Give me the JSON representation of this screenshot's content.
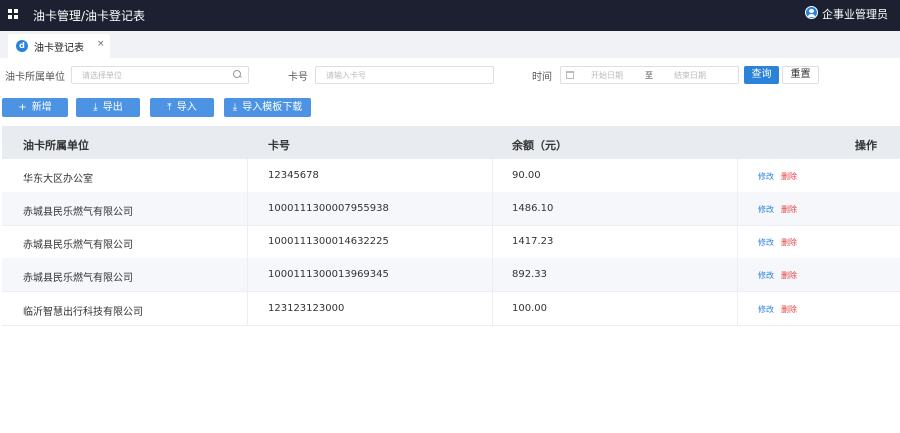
{
  "header": {
    "title": "油卡管理/油卡登记表",
    "user_name": "企事业管理员"
  },
  "tabs": [
    {
      "label": "油卡登记表",
      "icon_letter": "d",
      "close": "×"
    }
  ],
  "filters": {
    "unit_label": "油卡所属单位",
    "unit_placeholder": "请选择单位",
    "card_label": "卡号",
    "card_placeholder": "请输入卡号",
    "time_label": "时间",
    "start_placeholder": "开始日期",
    "date_separator": "至",
    "end_placeholder": "结束日期",
    "query_label": "查询",
    "reset_label": "重置"
  },
  "actions": {
    "add": {
      "icon": "+",
      "label": "新增"
    },
    "export": {
      "icon": "⤓",
      "label": "导出"
    },
    "import": {
      "icon": "⤒",
      "label": "导入"
    },
    "template": {
      "icon": "⤓",
      "label": "导入模板下载"
    }
  },
  "table": {
    "columns": [
      "油卡所属单位",
      "卡号",
      "余额（元）",
      "操作"
    ],
    "edit_label": "修改",
    "delete_label": "删除",
    "rows": [
      {
        "unit": "华东大区办公室",
        "card": "12345678",
        "balance": "90.00"
      },
      {
        "unit": "赤城县民乐燃气有限公司",
        "card": "1000111300007955938",
        "balance": "1486.10"
      },
      {
        "unit": "赤城县民乐燃气有限公司",
        "card": "1000111300014632225",
        "balance": "1417.23"
      },
      {
        "unit": "赤城县民乐燃气有限公司",
        "card": "1000111300013969345",
        "balance": "892.33"
      },
      {
        "unit": "临沂智慧出行科技有限公司",
        "card": "123123123000",
        "balance": "100.00"
      }
    ]
  },
  "colors": {
    "topbar": "#1c2030",
    "primary": "#2b83d9",
    "danger": "#e64242"
  }
}
